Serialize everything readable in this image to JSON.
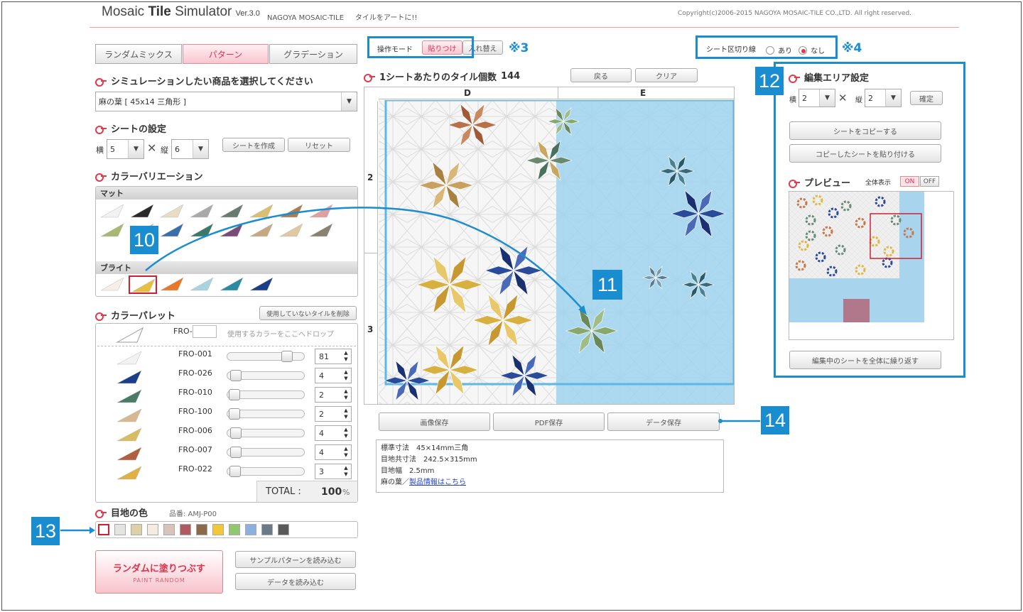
{
  "header": {
    "title_pre": "Mosaic ",
    "title_bold": "Tile",
    "title_post": " Simulator",
    "version": "Ver.3.0",
    "company": "NAGOYA MOSAIC-TILE",
    "tagline": "タイルをアートに!!",
    "copyright": "Copyright(c)2006-2015 NAGOYA MOSAIC-TILE CO.,LTD. All right reserved."
  },
  "tabs": [
    {
      "label": "ランダムミックス",
      "active": false
    },
    {
      "label": "パターン",
      "active": true
    },
    {
      "label": "グラデーション",
      "active": false
    }
  ],
  "product": {
    "heading": "シミュレーションしたい商品を選択してください",
    "selected": "麻の葉 [ 45x14 三角形 ]"
  },
  "sheet": {
    "heading": "シートの設定",
    "width_label": "横",
    "width_value": "5",
    "times": "✕",
    "height_label": "縦",
    "height_value": "6",
    "create_button": "シートを作成",
    "reset_button": "リセット"
  },
  "color_variation": {
    "heading": "カラーバリエーション",
    "group_matte": "マット",
    "group_bright": "ブライト",
    "matte_colors": [
      "#f2f2f2",
      "#2a2a2a",
      "#e8dcc2",
      "#a8aaa8",
      "#6a7a72",
      "#d8c070",
      "#b07a50",
      "#e0a0a0",
      "#a8b870",
      "#a8c4dc",
      "#3a6ea8",
      "#3a7868",
      "#7a4a78",
      "#c8a880",
      "#e0c8a0",
      "#8a8270"
    ],
    "bright_colors": [
      "#f4f0e6",
      "#e8c040",
      "#e8782a",
      "#a8d4e0",
      "#2a8ca0",
      "#1a3e8a"
    ]
  },
  "palette": {
    "heading": "カラーパレット",
    "delete_unused_button": "使用していないタイルを削除",
    "code_prefix": "FRO-",
    "drop_hint": "使用するカラーをここへドロップ",
    "items": [
      {
        "code": "FRO-001",
        "value": "81",
        "color": "#f2f2f2",
        "level": 0.81
      },
      {
        "code": "FRO-026",
        "value": "4",
        "color": "#1a3e8a",
        "level": 0.04
      },
      {
        "code": "FRO-010",
        "value": "2",
        "color": "#4a7a68",
        "level": 0.02
      },
      {
        "code": "FRO-100",
        "value": "2",
        "color": "#d8b890",
        "level": 0.02
      },
      {
        "code": "FRO-006",
        "value": "4",
        "color": "#d8bc60",
        "level": 0.04
      },
      {
        "code": "FRO-007",
        "value": "4",
        "color": "#b06040",
        "level": 0.04
      },
      {
        "code": "FRO-022",
        "value": "3",
        "color": "#e0b040",
        "level": 0.03
      }
    ],
    "total_label": "TOTAL :",
    "total_value": "100",
    "total_unit": "%"
  },
  "grout": {
    "heading": "目地の色",
    "code": "品番: AMJ-P00",
    "colors": [
      "#ffffff",
      "#e4e4e0",
      "#e0d0a8",
      "#f4ece0",
      "#d8c4b8",
      "#b05a60",
      "#8a6a48",
      "#f0c838",
      "#90c870",
      "#8cb0e0",
      "#6a7a88",
      "#5a5a5a"
    ]
  },
  "actions": {
    "random_fill": "ランダムに塗りつぶす",
    "random_fill_sub": "PAINT RANDOM",
    "load_sample": "サンプルパターンを読み込む",
    "load_data": "データを読み込む"
  },
  "toolbar": {
    "mode_label": "操作モード",
    "mode_paste": "貼りつけ",
    "mode_swap": "入れ替え",
    "note3": "※3",
    "sheet_divider_label": "シート区切り線",
    "divider_yes": "あり",
    "divider_no": "なし",
    "note4": "※4"
  },
  "canvas": {
    "tile_count_label": "1シートあたりのタイル個数",
    "tile_count": "144",
    "back_button": "戻る",
    "clear_button": "クリア",
    "col_labels": [
      "D",
      "E"
    ],
    "row_labels": [
      "2",
      "3"
    ]
  },
  "save": {
    "image": "画像保存",
    "pdf": "PDF保存",
    "data": "データ保存"
  },
  "info": {
    "line1": "標準寸法　45×14mm三角",
    "line2": "目地共寸法　242.5×315mm",
    "line3": "目地幅　2.5mm",
    "line4_prefix": "麻の葉／",
    "line4_link": "製品情報はこちら"
  },
  "edit_area": {
    "heading": "編集エリア設定",
    "width_label": "横",
    "width_value": "2",
    "times": "✕",
    "height_label": "縦",
    "height_value": "2",
    "confirm_button": "確定",
    "copy_sheet_button": "シートをコピーする",
    "paste_sheet_button": "コピーしたシートを貼り付ける",
    "preview_heading": "プレビュー",
    "full_view_label": "全体表示",
    "on": "ON",
    "off": "OFF",
    "repeat_button": "編集中のシートを全体に繰り返す"
  },
  "callouts": {
    "c10": "10",
    "c11": "11",
    "c12": "12",
    "c13": "13",
    "c14": "14"
  },
  "accent": "#1a8cd0",
  "brand": "#e23a4c"
}
